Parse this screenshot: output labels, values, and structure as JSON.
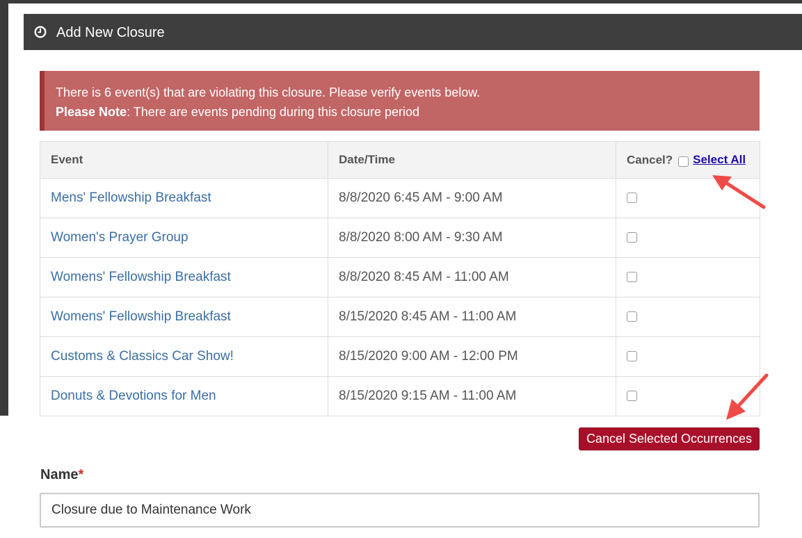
{
  "modal": {
    "title": "Add New Closure",
    "icon": "clock-icon",
    "header_color": "#3e3e3e"
  },
  "alert": {
    "line1": "There is 6 event(s) that are violating this closure. Please verify events below.",
    "note_label": "Please Note",
    "note_text": ": There are events pending during this closure period",
    "background": "#c26565"
  },
  "table": {
    "headers": {
      "event": "Event",
      "datetime": "Date/Time",
      "cancel": "Cancel?",
      "select_all": "Select All"
    },
    "rows": [
      {
        "event": "Mens' Fellowship Breakfast",
        "datetime": "8/8/2020 6:45 AM - 9:00 AM",
        "checked": false
      },
      {
        "event": "Women's Prayer Group",
        "datetime": "8/8/2020 8:00 AM - 9:30 AM",
        "checked": false
      },
      {
        "event": "Womens' Fellowship Breakfast",
        "datetime": "8/8/2020 8:45 AM - 11:00 AM",
        "checked": false
      },
      {
        "event": "Womens' Fellowship Breakfast",
        "datetime": "8/15/2020 8:45 AM - 11:00 AM",
        "checked": false
      },
      {
        "event": "Customs & Classics Car Show!",
        "datetime": "8/15/2020 9:00 AM - 12:00 PM",
        "checked": false
      },
      {
        "event": "Donuts & Devotions for Men",
        "datetime": "8/15/2020 9:15 AM - 11:00 AM",
        "checked": false
      }
    ]
  },
  "actions": {
    "cancel_selected_label": "Cancel Selected Occurrences",
    "button_color": "#a8102a"
  },
  "form": {
    "name_label": "Name",
    "required_marker": "*",
    "name_value": "Closure due to Maintenance Work"
  },
  "annotations": {
    "arrow_color": "#ee4b47"
  }
}
